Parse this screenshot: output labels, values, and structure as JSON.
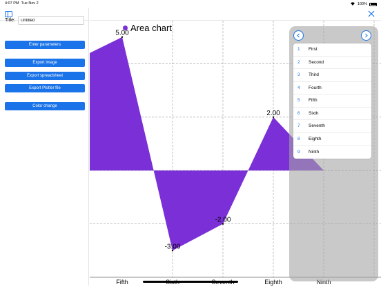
{
  "status_bar": {
    "time": "4:07 PM",
    "date": "Tue Nov 2",
    "battery": "100%"
  },
  "sidebar": {
    "title_label": "Title:",
    "title_value": "Untitled",
    "buttons": {
      "enter_parameters": "Enter parameters",
      "export_image": "Export image",
      "export_spreadsheet": "Export spreadsheet",
      "export_plotter": "Export Plotter file",
      "color_change": "Color change"
    }
  },
  "colors": {
    "accent": "#1a73e8",
    "series": "#7b2fd6"
  },
  "chart_data": {
    "type": "area",
    "title": "Area chart",
    "categories": [
      "Fifth",
      "Sixth",
      "Seventh",
      "Eighth",
      "Ninth"
    ],
    "series": [
      {
        "name": "Area chart",
        "values": [
          5.0,
          -3.0,
          -2.0,
          2.0,
          0
        ]
      }
    ],
    "data_labels": [
      "5.00",
      "-3.00",
      "-2.00",
      "2.00"
    ],
    "ylim": [
      -4,
      6
    ],
    "grid": true,
    "legend": "top-left"
  },
  "panel": {
    "prev_icon": "chevron-left-icon",
    "next_icon": "chevron-right-icon",
    "items": [
      {
        "index": "1",
        "label": "First"
      },
      {
        "index": "2",
        "label": "Second"
      },
      {
        "index": "3",
        "label": "Third"
      },
      {
        "index": "4",
        "label": "Fourth"
      },
      {
        "index": "5",
        "label": "Fifth"
      },
      {
        "index": "6",
        "label": "Sixth"
      },
      {
        "index": "7",
        "label": "Seventh"
      },
      {
        "index": "8",
        "label": "Eighth"
      },
      {
        "index": "9",
        "label": "Ninth"
      }
    ]
  }
}
